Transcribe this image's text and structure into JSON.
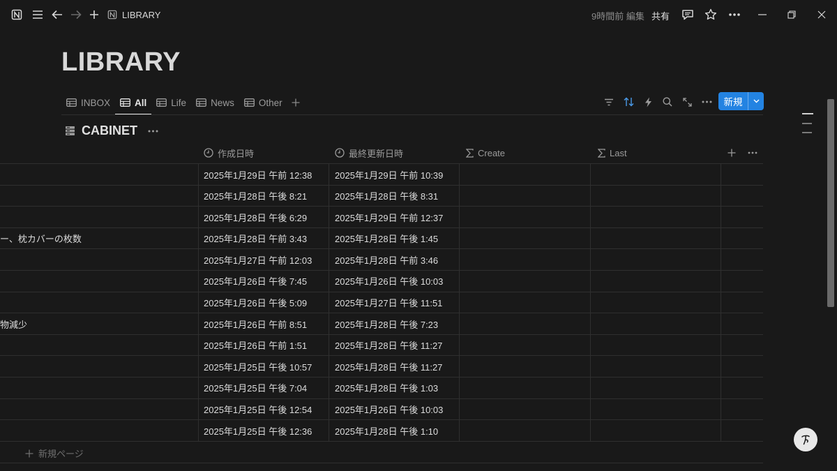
{
  "topbar": {
    "title": "LIBRARY",
    "edited": "9時間前 編集",
    "share": "共有"
  },
  "page": {
    "title": "LIBRARY"
  },
  "views": [
    {
      "label": "INBOX"
    },
    {
      "label": "All"
    },
    {
      "label": "Life"
    },
    {
      "label": "News"
    },
    {
      "label": "Other"
    }
  ],
  "toolbar": {
    "new_label": "新規"
  },
  "database": {
    "title": "CABINET"
  },
  "columns": {
    "created": "作成日時",
    "updated": "最終更新日時",
    "create": "Create",
    "last": "Last"
  },
  "rows": [
    {
      "name": "",
      "created": "2025年1月29日 午前 12:38",
      "updated": "2025年1月29日 午前 10:39"
    },
    {
      "name": "",
      "created": "2025年1月28日 午後 8:21",
      "updated": "2025年1月28日 午後 8:31"
    },
    {
      "name": "",
      "created": "2025年1月28日 午後 6:29",
      "updated": "2025年1月29日 午前 12:37"
    },
    {
      "name": "ー、枕カバーの枚数",
      "created": "2025年1月28日 午前 3:43",
      "updated": "2025年1月28日 午後 1:45"
    },
    {
      "name": "",
      "created": "2025年1月27日 午前 12:03",
      "updated": "2025年1月28日 午前 3:46"
    },
    {
      "name": "",
      "created": "2025年1月26日 午後 7:45",
      "updated": "2025年1月26日 午後 10:03"
    },
    {
      "name": "",
      "created": "2025年1月26日 午後 5:09",
      "updated": "2025年1月27日 午後 11:51"
    },
    {
      "name": "物減少",
      "created": "2025年1月26日 午前 8:51",
      "updated": "2025年1月28日 午後 7:23"
    },
    {
      "name": "",
      "created": "2025年1月26日 午前 1:51",
      "updated": "2025年1月28日 午後 11:27"
    },
    {
      "name": "",
      "created": "2025年1月25日 午後 10:57",
      "updated": "2025年1月28日 午後 11:27"
    },
    {
      "name": "",
      "created": "2025年1月25日 午後 7:04",
      "updated": "2025年1月28日 午後 1:03"
    },
    {
      "name": "",
      "created": "2025年1月25日 午後 12:54",
      "updated": "2025年1月26日 午後 10:03"
    },
    {
      "name": "",
      "created": "2025年1月25日 午後 12:36",
      "updated": "2025年1月28日 午後 1:10"
    }
  ],
  "footer": {
    "new_page": "新規ページ"
  },
  "colors": {
    "background": "#191919",
    "accent": "#2383e2",
    "text": "#d4d4d4",
    "muted": "#9b9b9b"
  }
}
